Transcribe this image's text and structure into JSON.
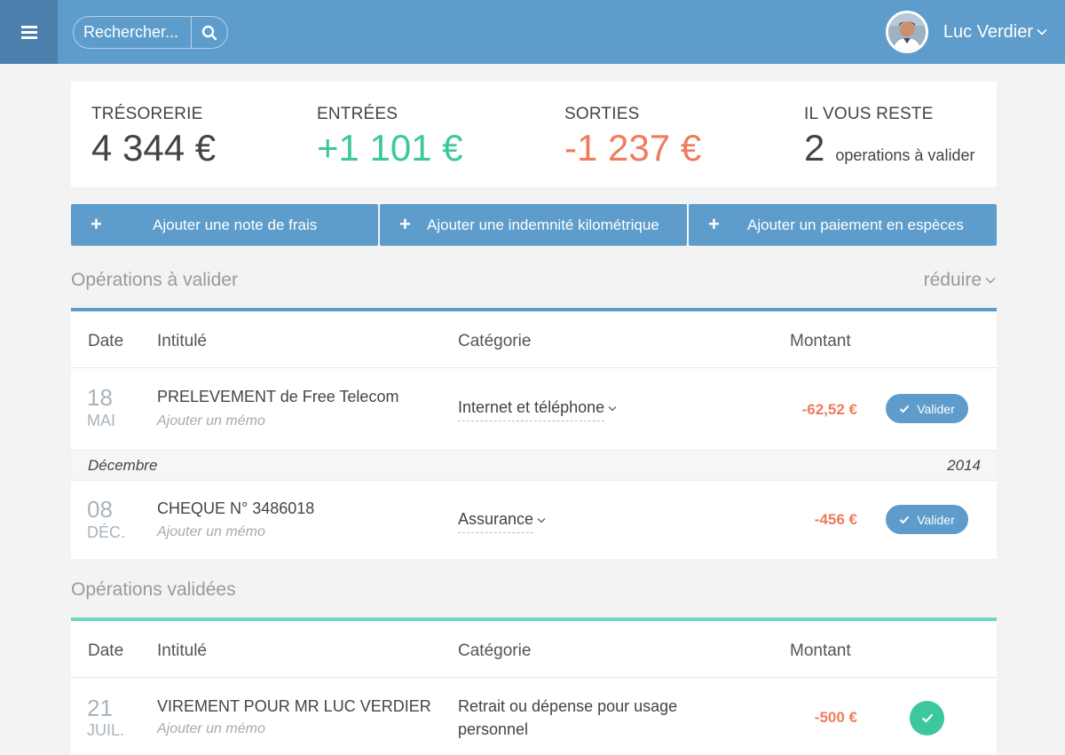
{
  "header": {
    "search_placeholder": "Rechercher...",
    "user_name": "Luc Verdier"
  },
  "summary": {
    "tresorerie_label": "TRÉSORERIE",
    "tresorerie_value": "4 344 €",
    "entrees_label": "ENTRÉES",
    "entrees_value": "+1 101 €",
    "sorties_label": "SORTIES",
    "sorties_value": "-1 237 €",
    "reste_label": "IL VOUS RESTE",
    "reste_value": "2",
    "reste_text": "operations à valider"
  },
  "actions": {
    "note_frais": "Ajouter une note de frais",
    "indemnite": "Ajouter une indemnité kilométrique",
    "paiement": "Ajouter un paiement en espèces"
  },
  "pending": {
    "title": "Opérations à valider",
    "reduce_label": "réduire",
    "columns": {
      "date": "Date",
      "intitule": "Intitulé",
      "categorie": "Catégorie",
      "montant": "Montant"
    },
    "rows": [
      {
        "day": "18",
        "month": "MAI",
        "intitule": "PRELEVEMENT de Free Telecom",
        "memo": "Ajouter un mémo",
        "categorie": "Internet et téléphone",
        "montant": "-62,52 €",
        "action": "Valider"
      },
      {
        "day": "08",
        "month": "DÉC.",
        "intitule": "CHEQUE N° 3486018",
        "memo": "Ajouter un mémo",
        "categorie": "Assurance",
        "montant": "-456 €",
        "action": "Valider"
      }
    ],
    "group": {
      "month": "Décembre",
      "year": "2014"
    }
  },
  "validated": {
    "title": "Opérations validées",
    "columns": {
      "date": "Date",
      "intitule": "Intitulé",
      "categorie": "Catégorie",
      "montant": "Montant"
    },
    "rows": [
      {
        "day": "21",
        "month": "JUIL.",
        "intitule": "VIREMENT POUR MR LUC VERDIER",
        "memo": "Ajouter un mémo",
        "categorie_line1": "Retrait ou dépense pour usage",
        "categorie_line2": "personnel",
        "montant": "-500 €"
      }
    ]
  },
  "colors": {
    "primary": "#5d9ccb",
    "primary_dark": "#4a80ab",
    "positive": "#3cc79e",
    "negative": "#ef7c5c",
    "validated_accent": "#6dd5c1"
  },
  "icons": {
    "menu": "hamburger-icon",
    "search": "magnifier-icon",
    "user_caret": "chevron-down-icon",
    "add": "plus-icon",
    "check": "check-icon"
  }
}
